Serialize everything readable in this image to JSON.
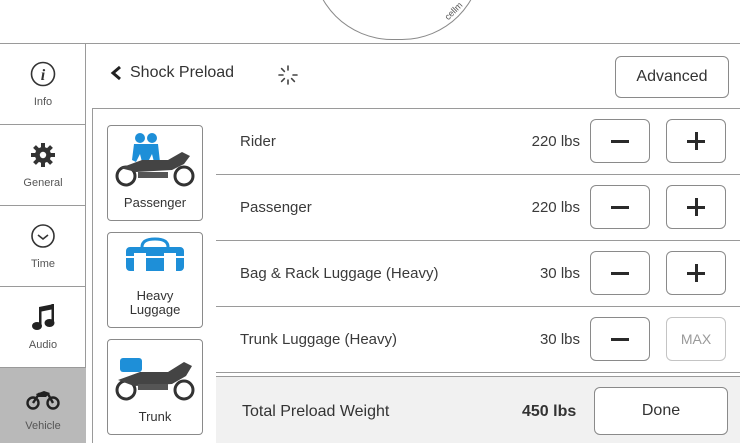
{
  "watermark": "cellm",
  "nav": {
    "items": [
      {
        "label": "Info",
        "icon": "info-icon"
      },
      {
        "label": "General",
        "icon": "gear-icon"
      },
      {
        "label": "Time",
        "icon": "clock-icon"
      },
      {
        "label": "Audio",
        "icon": "music-note-icon"
      },
      {
        "label": "Vehicle",
        "icon": "motorcycle-icon",
        "active": true
      }
    ]
  },
  "header": {
    "title": "Shock Preload",
    "advanced_label": "Advanced"
  },
  "presets": [
    {
      "label": "Passenger"
    },
    {
      "label": "Heavy Luggage",
      "line1": "Heavy",
      "line2": "Luggage"
    },
    {
      "label": "Trunk"
    }
  ],
  "loads": [
    {
      "name": "Rider",
      "value": "220 lbs",
      "max_reached": false
    },
    {
      "name": "Passenger",
      "value": "220 lbs",
      "max_reached": false
    },
    {
      "name": "Bag & Rack Luggage (Heavy)",
      "value": "30 lbs",
      "max_reached": false
    },
    {
      "name": "Trunk Luggage (Heavy)",
      "value": "30 lbs",
      "max_reached": true,
      "max_label": "MAX"
    }
  ],
  "total": {
    "label": "Total Preload Weight",
    "value": "450 lbs",
    "done_label": "Done"
  },
  "colors": {
    "accent_blue": "#1e8fd8",
    "active_nav": "#b9b9b9",
    "border": "#8a8a8a"
  }
}
